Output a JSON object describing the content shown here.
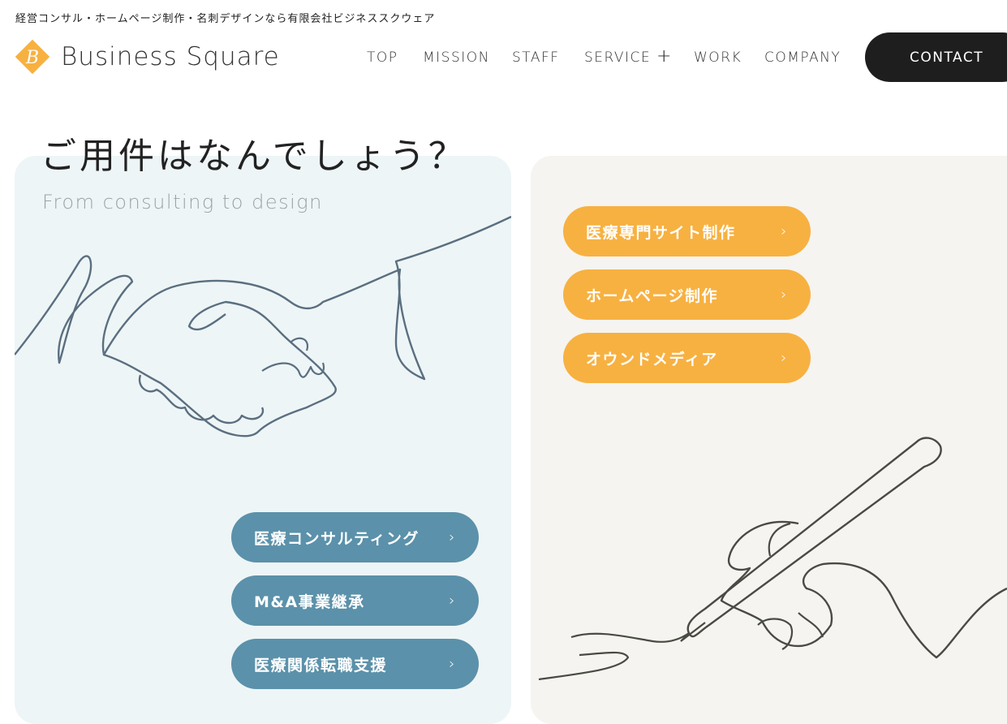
{
  "header": {
    "tagline": "経営コンサル・ホームページ制作・名刺デザインなら有限会社ビジネススクウェア",
    "logo_letter": "B",
    "logo_text": "Business Square",
    "nav": [
      "TOP",
      "MISSION",
      "STAFF",
      "SERVICE",
      "WORK",
      "COMPANY"
    ],
    "plus": "+",
    "contact_label": "CONTACT"
  },
  "main": {
    "heading": "ご用件はなんでしょう？",
    "subheading": "From consulting to design",
    "left_buttons": [
      "医療コンサルティング",
      "M&A事業継承",
      "医療関係転職支援"
    ],
    "right_buttons": [
      "医療専門サイト制作",
      "ホームページ制作",
      "オウンドメディア"
    ],
    "chevron": "›"
  },
  "colors": {
    "brand_orange": "#f7b141",
    "button_blue": "#5b91aa",
    "contact_bg": "#1e1e1e",
    "left_panel_bg": "#eef5f6",
    "right_panel_bg": "#f5f4f0"
  },
  "icons": [
    "logo-diamond-icon",
    "plus-icon",
    "chevron-right-icon",
    "handshake-illustration",
    "writing-hand-illustration"
  ]
}
